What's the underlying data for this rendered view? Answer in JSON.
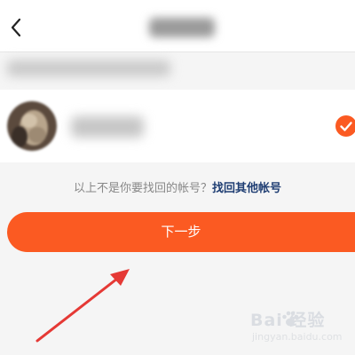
{
  "header": {
    "back_icon": "chevron-left-icon"
  },
  "prompt": {
    "text": "以上不是你要找回的帐号？",
    "link": "找回其他帐号"
  },
  "next_button": {
    "label": "下一步"
  },
  "colors": {
    "accent": "#fb5a22",
    "link": "#1f3e73",
    "page_background": "#f5f5f5",
    "annotation_arrow": "#e53935"
  },
  "watermark": {
    "brand": "Bai 经验",
    "url": "jingyan.baidu.com"
  }
}
